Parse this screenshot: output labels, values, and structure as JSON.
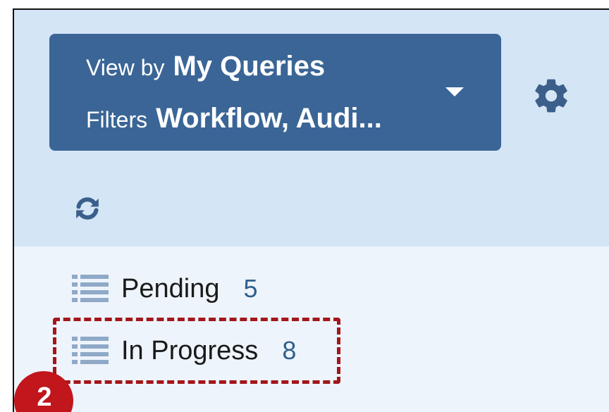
{
  "panel": {
    "view_by_label": "View by",
    "view_by_value": "My Queries",
    "filters_label": "Filters",
    "filters_value": "Workflow, Audi..."
  },
  "icons": {
    "dropdown": "chevron-down-icon",
    "settings": "gear-icon",
    "refresh": "refresh-icon",
    "list": "list-icon"
  },
  "items": [
    {
      "label": "Pending",
      "count": "5"
    },
    {
      "label": "In Progress",
      "count": "8"
    }
  ],
  "callout": {
    "number": "2"
  },
  "colors": {
    "header_bg": "#d4e5f6",
    "button_bg": "#3a6596",
    "accent_red": "#c0161c"
  }
}
